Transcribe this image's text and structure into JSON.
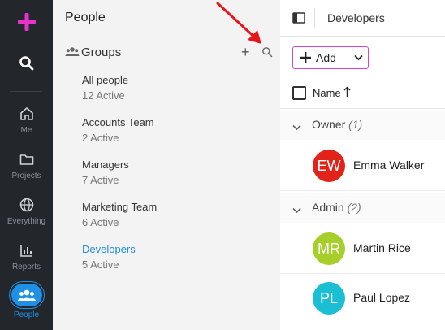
{
  "rail": {
    "items": [
      {
        "label": "Me",
        "icon": "home-icon"
      },
      {
        "label": "Projects",
        "icon": "folder-icon"
      },
      {
        "label": "Everything",
        "icon": "globe-icon"
      },
      {
        "label": "Reports",
        "icon": "bar-chart-icon"
      },
      {
        "label": "People",
        "icon": "people-icon"
      }
    ],
    "active": "People"
  },
  "panel": {
    "title": "People",
    "groups_label": "Groups",
    "add_symbol": "+",
    "groups": [
      {
        "name": "All people",
        "sub": "12 Active"
      },
      {
        "name": "Accounts Team",
        "sub": "2 Active"
      },
      {
        "name": "Managers",
        "sub": "7 Active"
      },
      {
        "name": "Marketing Team",
        "sub": "6 Active"
      },
      {
        "name": "Developers",
        "sub": "5 Active"
      }
    ],
    "selected": "Developers"
  },
  "main": {
    "breadcrumb": "Developers",
    "add_label": "Add",
    "column_name": "Name",
    "sections": [
      {
        "label": "Owner",
        "count": "(1)"
      },
      {
        "label": "Admin",
        "count": "(2)"
      }
    ],
    "people": [
      {
        "initials": "EW",
        "name": "Emma Walker",
        "color": "#e2231a"
      },
      {
        "initials": "MR",
        "name": "Martin Rice",
        "color": "#a6cf2a"
      },
      {
        "initials": "PL",
        "name": "Paul Lopez",
        "color": "#1bbfd3"
      }
    ]
  },
  "colors": {
    "accent": "#1e90e6",
    "brand": "#e633cc",
    "add_border": "#d046d0",
    "annotation_arrow": "#e8141a"
  }
}
